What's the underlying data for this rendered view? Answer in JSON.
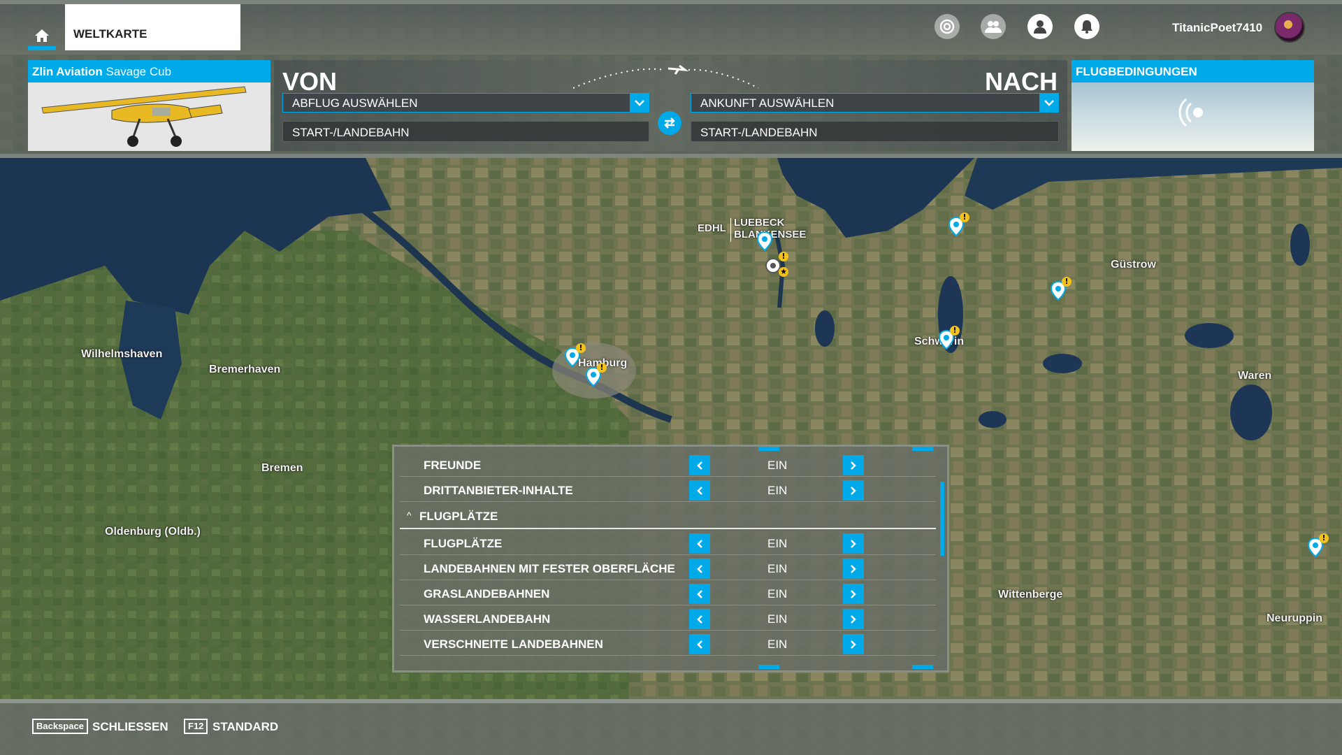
{
  "topbar": {
    "tab_label": "WELTKARTE",
    "username": "TitanicPoet7410"
  },
  "flight": {
    "aircraft_brand": "Zlin Aviation",
    "aircraft_model": "Savage Cub",
    "from_label": "VON",
    "to_label": "NACH",
    "departure_placeholder": "ABFLUG AUSWÄHLEN",
    "arrival_placeholder": "ANKUNFT AUSWÄHLEN",
    "departure_runway": "START-/LANDEBAHN",
    "arrival_runway": "START-/LANDEBAHN",
    "conditions_label": "FLUGBEDINGUNGEN"
  },
  "map": {
    "cities": [
      {
        "name": "Wilhelmshaven"
      },
      {
        "name": "Bremerhaven"
      },
      {
        "name": "Bremen"
      },
      {
        "name": "Oldenburg (Oldb.)"
      },
      {
        "name": "Hamburg"
      },
      {
        "name": "Schwerin"
      },
      {
        "name": "Güstrow"
      },
      {
        "name": "Waren"
      },
      {
        "name": "Wittenberge"
      },
      {
        "name": "Neuruppin"
      }
    ],
    "airport_code": "EDHL",
    "airport_name_line1": "LUEBECK",
    "airport_name_line2": "BLANKENSEE"
  },
  "filter": {
    "rows": [
      {
        "label": "FREUNDE",
        "value": "EIN"
      },
      {
        "label": "DRITTANBIETER-INHALTE",
        "value": "EIN"
      }
    ],
    "section": "FLUGPLÄTZE",
    "section_rows": [
      {
        "label": "FLUGPLÄTZE",
        "value": "EIN"
      },
      {
        "label": "LANDEBAHNEN MIT FESTER OBERFLÄCHE",
        "value": "EIN"
      },
      {
        "label": "GRASLANDEBAHNEN",
        "value": "EIN"
      },
      {
        "label": "WASSERLANDEBAHN",
        "value": "EIN"
      },
      {
        "label": "VERSCHNEITE LANDEBAHNEN",
        "value": "EIN"
      }
    ]
  },
  "bottombar": {
    "key1": "Backspace",
    "key1_label": "SCHLIESSEN",
    "key2": "F12",
    "key2_label": "STANDARD"
  },
  "colors": {
    "accent": "#00a9e8",
    "warning": "#f2c21a"
  }
}
